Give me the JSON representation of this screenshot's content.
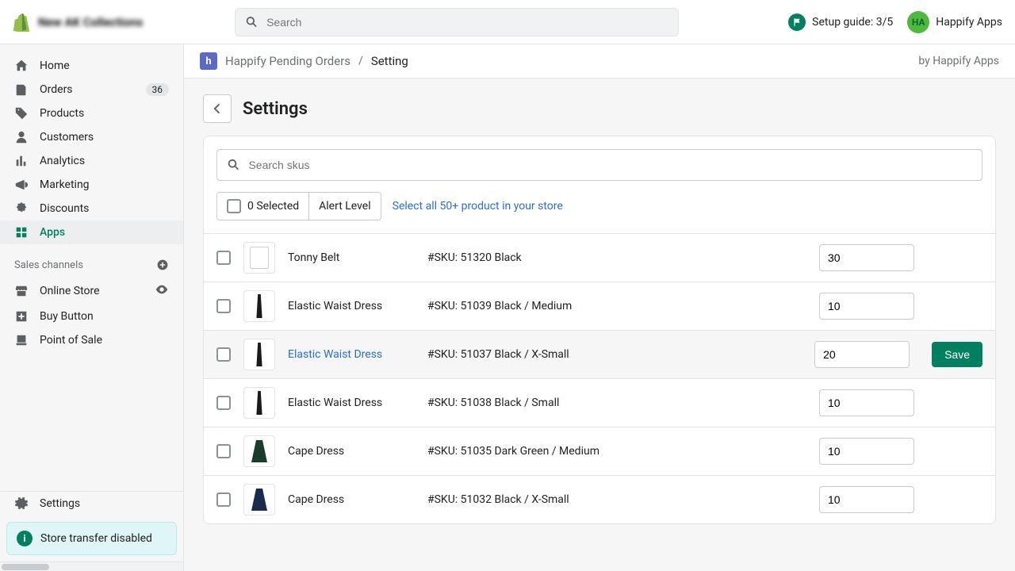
{
  "top": {
    "store_name": "New AK Collections",
    "search_placeholder": "Search",
    "setup_label": "Setup guide: 3/5",
    "avatar_initials": "HA",
    "user_name": "Happify Apps"
  },
  "sidebar": {
    "items": [
      {
        "label": "Home"
      },
      {
        "label": "Orders",
        "badge": "36"
      },
      {
        "label": "Products"
      },
      {
        "label": "Customers"
      },
      {
        "label": "Analytics"
      },
      {
        "label": "Marketing"
      },
      {
        "label": "Discounts"
      },
      {
        "label": "Apps"
      }
    ],
    "section_label": "Sales channels",
    "channels": [
      {
        "label": "Online Store"
      },
      {
        "label": "Buy Button"
      },
      {
        "label": "Point of Sale"
      }
    ],
    "settings_label": "Settings",
    "transfer_label": "Store transfer disabled"
  },
  "appbar": {
    "crumb_app": "Happify Pending Orders",
    "crumb_current": "Setting",
    "byline": "by Happify Apps",
    "logo_letter": "h"
  },
  "page": {
    "title": "Settings",
    "sku_search_placeholder": "Search skus",
    "selected_label": "0 Selected",
    "alert_label": "Alert Level",
    "select_all_label": "Select all 50+ product in your store",
    "save_label": "Save"
  },
  "rows": [
    {
      "name": "Tonny Belt",
      "sku": "#SKU: 51320 Black",
      "qty": "30",
      "thumb": "shirt"
    },
    {
      "name": "Elastic Waist Dress",
      "sku": "#SKU: 51039 Black / Medium",
      "qty": "10",
      "thumb": "dress"
    },
    {
      "name": "Elastic Waist Dress",
      "sku": "#SKU: 51037 Black / X-Small",
      "qty": "20",
      "thumb": "dress",
      "hover": true,
      "link": true,
      "save": true
    },
    {
      "name": "Elastic Waist Dress",
      "sku": "#SKU: 51038 Black / Small",
      "qty": "10",
      "thumb": "dress"
    },
    {
      "name": "Cape Dress",
      "sku": "#SKU: 51035 Dark Green / Medium",
      "qty": "10",
      "thumb": "cape green"
    },
    {
      "name": "Cape Dress",
      "sku": "#SKU: 51032 Black / X-Small",
      "qty": "10",
      "thumb": "cape"
    }
  ]
}
